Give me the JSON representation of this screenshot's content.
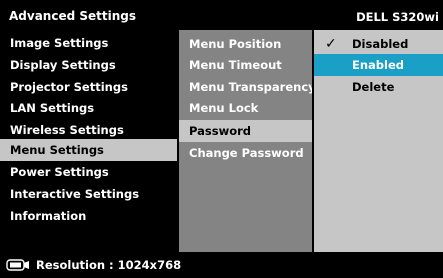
{
  "header": {
    "title": "Advanced Settings",
    "model": "DELL S320wi"
  },
  "main_menu": [
    {
      "label": "Image Settings"
    },
    {
      "label": "Display Settings"
    },
    {
      "label": "Projector Settings"
    },
    {
      "label": "LAN Settings"
    },
    {
      "label": "Wireless Settings"
    },
    {
      "label": "Menu Settings"
    },
    {
      "label": "Power Settings"
    },
    {
      "label": "Interactive Settings"
    },
    {
      "label": "Information"
    }
  ],
  "sub_menu": [
    {
      "label": "Menu Position"
    },
    {
      "label": "Menu Timeout"
    },
    {
      "label": "Menu Transparency"
    },
    {
      "label": "Menu Lock"
    },
    {
      "label": "Password"
    },
    {
      "label": "Change Password"
    }
  ],
  "options": [
    {
      "label": "Disabled",
      "checked": true
    },
    {
      "label": "Enabled"
    },
    {
      "label": "Delete"
    }
  ],
  "footer": {
    "resolution": "Resolution : 1024x768"
  },
  "colors": {
    "highlight_grey": "#c6c6c6",
    "panel_grey": "#848484",
    "selected_blue": "#1aa0c6",
    "background": "#000000"
  },
  "icons": {
    "check": "checkmark-icon",
    "resolution": "monitor-icon"
  }
}
